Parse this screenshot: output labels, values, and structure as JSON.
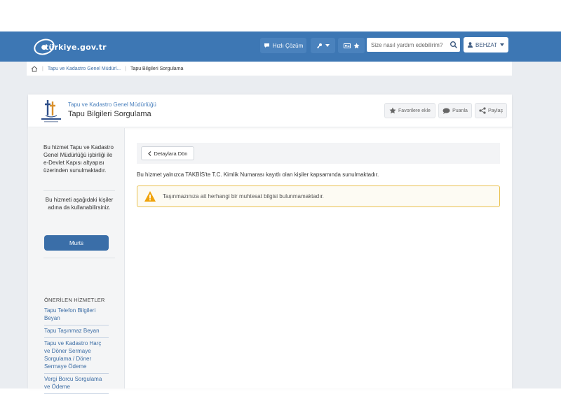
{
  "header": {
    "logo_text": "türkiye.gov.tr",
    "quick_solution_label": "Hızlı Çözüm",
    "search": {
      "placeholder": "Size nasıl yardım edebilirim?"
    },
    "user_label": "BEHZAT"
  },
  "breadcrumb": {
    "items": [
      "Tapu ve Kadastro Genel Müdürl...",
      "Tapu Bilgileri Sorgulama"
    ]
  },
  "service": {
    "institution": "Tapu ve Kadastro Genel Müdürlüğü",
    "title": "Tapu Bilgileri Sorgulama",
    "actions": {
      "favorite": "Favorilere ekle",
      "rate": "Puanla",
      "share": "Paylaş"
    }
  },
  "sidebar": {
    "intro": "Bu hizmet Tapu ve Kadastro Genel Müdürlüğü işbirliği ile e-Devlet Kapısı altyapısı üzerinden sunulmaktadır.",
    "note": "Bu hizmeti aşağıdaki kişiler adına da kullanabilirsiniz.",
    "murts_label": "Murts",
    "recommended_title": "ÖNERİLEN HİZMETLER",
    "recommended": [
      "Tapu Telefon Bilgileri Beyan",
      "Tapu Taşınmaz Beyan",
      "Tapu ve Kadastro Harç ve Döner Sermaye Sorgulama / Döner Sermaye Ödeme",
      "Vergi Borcu Sorgulama ve Ödeme"
    ]
  },
  "content": {
    "back_label": "Detaylara Dön",
    "info": "Bu hizmet yalnızca TAKBİS'te T.C. Kimlik Numarası kayıtlı olan kişiler kapsamında sunulmaktadır.",
    "warning": "Taşınmazınıza ait herhangi bir muhtesat bilgisi bulunmamaktadır."
  },
  "colors": {
    "header_blue": "#3d77b4",
    "primary_button": "#3a6ea8",
    "warning_border": "#e9c14f",
    "warning_icon": "#f0a30a",
    "link_blue": "#3d6ea5"
  }
}
